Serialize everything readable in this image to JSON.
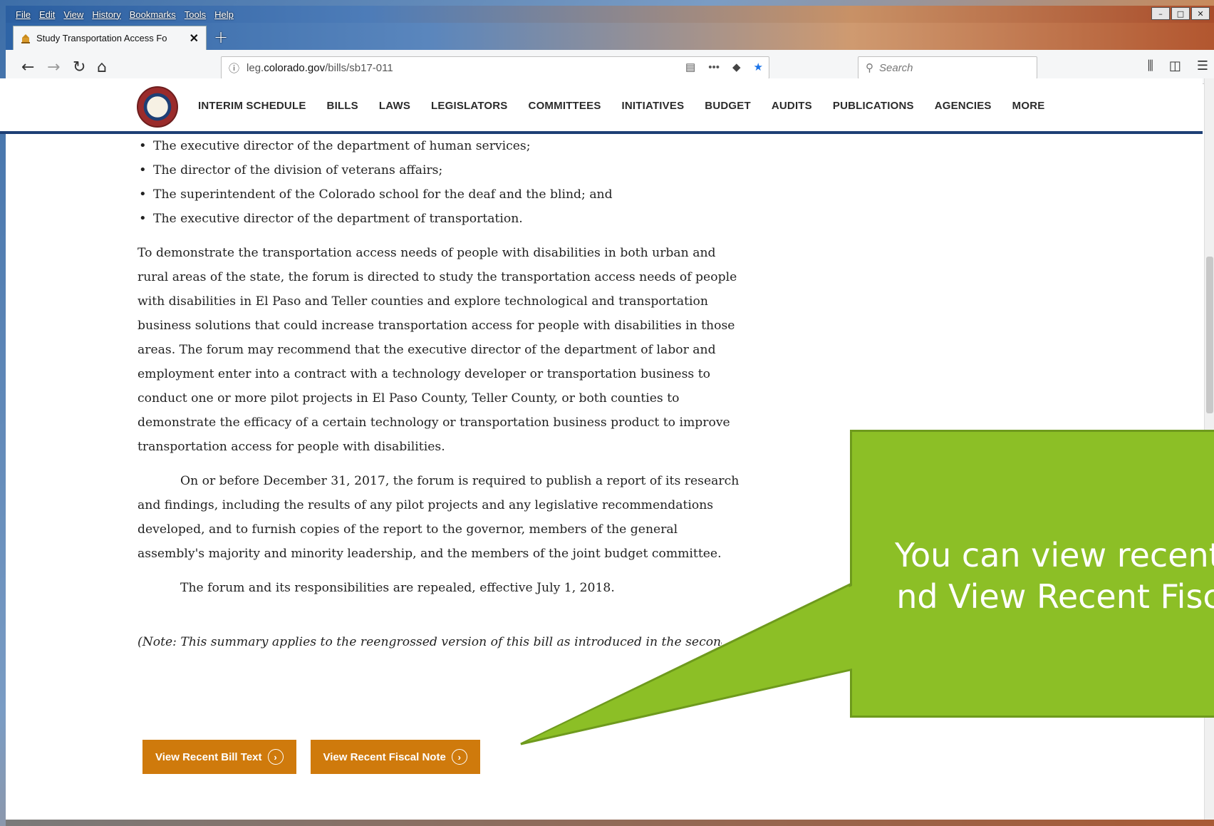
{
  "menubar": {
    "items": [
      "File",
      "Edit",
      "View",
      "History",
      "Bookmarks",
      "Tools",
      "Help"
    ]
  },
  "tab": {
    "title": "Study Transportation Access Fo",
    "close": "✕",
    "new_tab": "+"
  },
  "url": {
    "prefix": "leg.",
    "domain": "colorado.gov",
    "path": "/bills/sb17-011"
  },
  "search": {
    "placeholder": "Search"
  },
  "site_nav": [
    "INTERIM SCHEDULE",
    "BILLS",
    "LAWS",
    "LEGISLATORS",
    "COMMITTEES",
    "INITIATIVES",
    "BUDGET",
    "AUDITS",
    "PUBLICATIONS",
    "AGENCIES",
    "MORE"
  ],
  "content": {
    "bullets": [
      "The executive director of the department of human services;",
      "The director of the division of veterans affairs;",
      "The superintendent of the Colorado school for the deaf and the blind; and",
      "The executive director of the department of transportation."
    ],
    "para1_lines": [
      "To demonstrate the transportation access needs of people with disabilities in both urban and",
      "rural areas of the state, the forum is directed to study the transportation access needs of people",
      "with disabilities in El Paso and Teller counties and explore technological and transportation",
      "business solutions that could increase transportation access for people with disabilities in those",
      "areas. The forum may recommend that the executive director of the department of labor and",
      "employment enter into a contract with a technology developer or transportation business to",
      "conduct one or more pilot projects in El Paso County, Teller County, or both counties to",
      "demonstrate the efficacy of a certain technology or transportation business product to improve",
      "transportation access for people with disabilities."
    ],
    "para2_lines": [
      "On or before December 31, 2017, the forum is required to publish a report of its research",
      "and findings, including the results of any pilot projects and any legislative recommendations",
      "developed, and to furnish copies of the report to the governor, members of the general",
      "assembly's majority and minority leadership, and the members of the joint budget committee."
    ],
    "para3": "The forum and its responsibilities are repealed, effective July 1, 2018.",
    "note": "(Note: This summary applies to the reengrossed version of this bill as introduced in the second ho"
  },
  "buttons": {
    "bill_text": "View Recent Bill Text",
    "fiscal_note": "View Recent Fiscal Note",
    "arrow": "›"
  },
  "callout": {
    "line1": "You can view recent",
    "line2": "and View Recent Fisc"
  },
  "colors": {
    "callout": "#8cbf26",
    "button": "#cf7a0c",
    "nav_border": "#1d3f75"
  }
}
